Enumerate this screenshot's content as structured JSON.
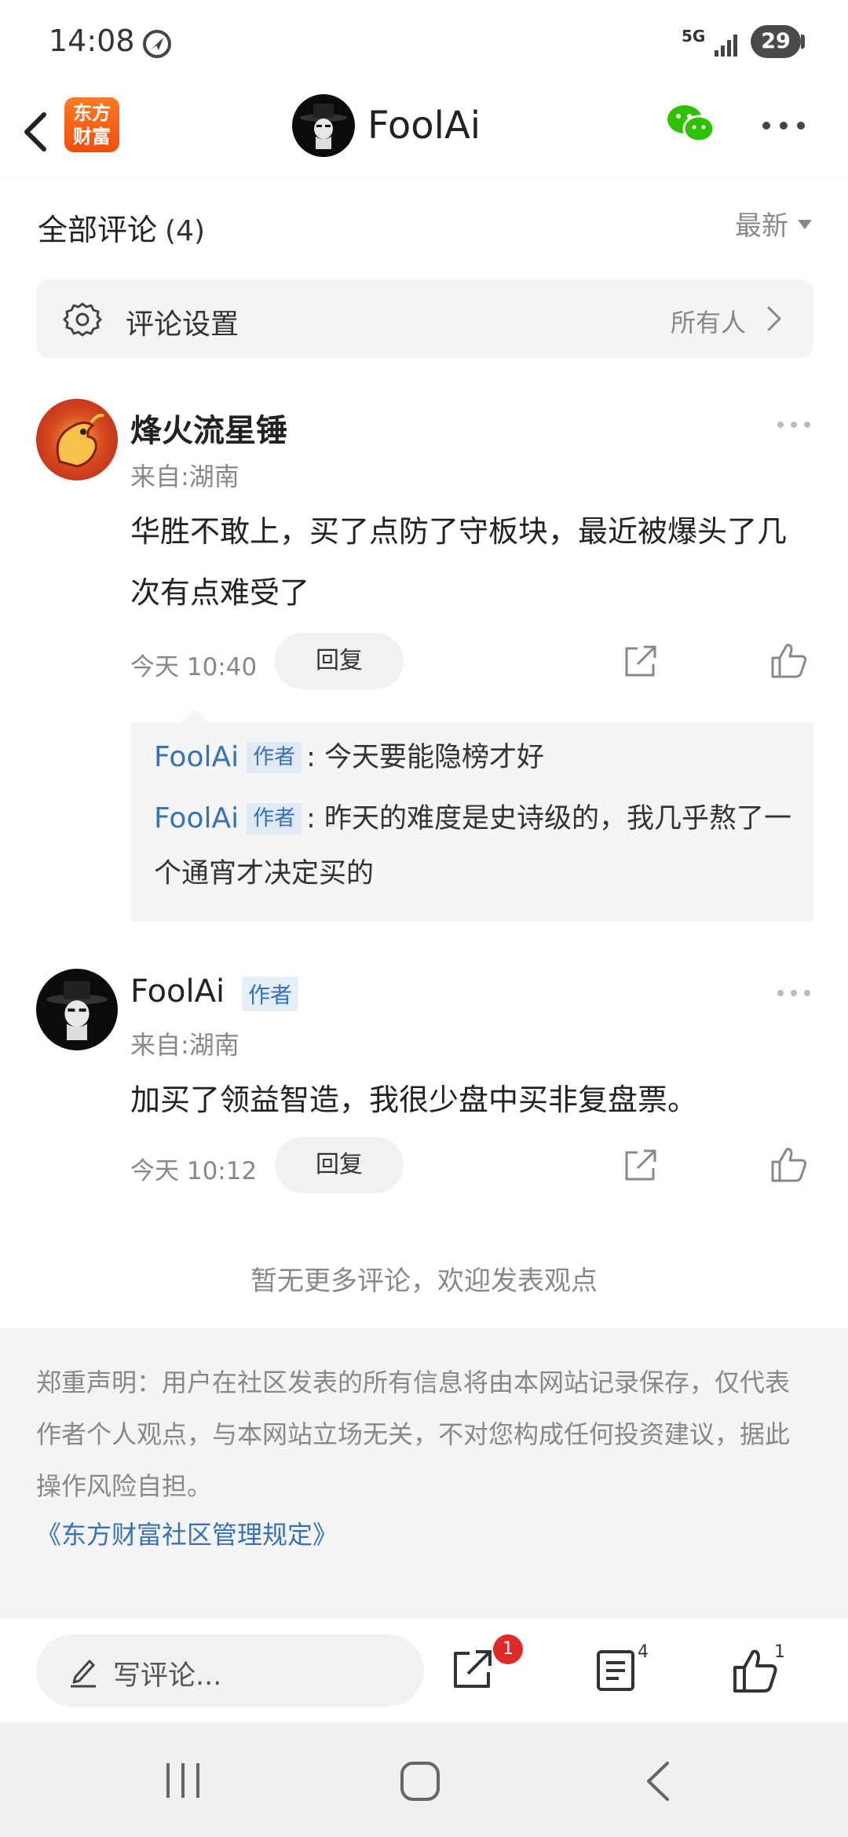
{
  "status_bar": {
    "time": "14:08",
    "network": "5G",
    "battery": "29"
  },
  "header": {
    "app_logo_line1": "东方",
    "app_logo_line2": "财富",
    "title": "FoolAi"
  },
  "comments_section": {
    "title": "全部评论",
    "count": "(4)",
    "sort_label": "最新",
    "settings_label": "评论设置",
    "settings_value": "所有人"
  },
  "comments": [
    {
      "name": "烽火流星锤",
      "location": "来自:湖南",
      "text": "华胜不敢上，买了点防了守板块，最近被爆头了几次有点难受了",
      "time": "今天 10:40",
      "reply_label": "回复",
      "replies": [
        {
          "name": "FoolAi",
          "tag": "作者",
          "text": ": 今天要能隐榜才好"
        },
        {
          "name": "FoolAi",
          "tag": "作者",
          "text": ": 昨天的难度是史诗级的，我几乎熬了一个通宵才决定买的"
        }
      ]
    },
    {
      "name": "FoolAi",
      "tag": "作者",
      "location": "来自:湖南",
      "text": "加买了领益智造，我很少盘中买非复盘票。",
      "time": "今天 10:12",
      "reply_label": "回复"
    }
  ],
  "no_more": "暂无更多评论，欢迎发表观点",
  "disclaimer": {
    "text": "郑重声明：用户在社区发表的所有信息将由本网站记录保存，仅代表作者个人观点，与本网站立场无关，不对您构成任何投资建议，据此操作风险自担。",
    "link": "《东方财富社区管理规定》"
  },
  "toolbar": {
    "placeholder": "写评论...",
    "share_badge": "1",
    "comment_count": "4",
    "like_count": "1"
  },
  "icons": {
    "status": [
      "navigation-icon",
      "signal-icon",
      "battery-icon"
    ],
    "header": [
      "back-icon",
      "wechat-icon",
      "more-icon"
    ],
    "toolbar": [
      "pen-icon",
      "share-icon",
      "list-icon",
      "like-icon"
    ],
    "navbar": [
      "recent-apps-icon",
      "home-icon",
      "back-icon"
    ]
  },
  "colors": {
    "link": "#3572b8",
    "badge": "#e02a2a",
    "logo": "#f04d12"
  }
}
